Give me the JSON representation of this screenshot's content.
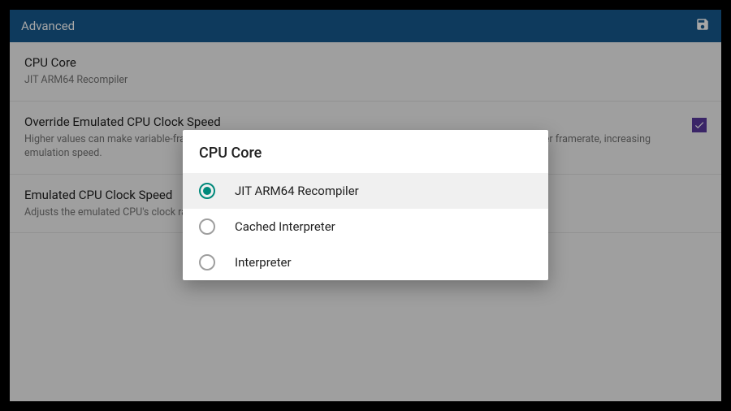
{
  "toolbar": {
    "title": "Advanced"
  },
  "settings": {
    "cpu_core": {
      "title": "CPU Core",
      "value": "JIT ARM64 Recompiler"
    },
    "override_clock": {
      "title": "Override Emulated CPU Clock Speed",
      "description": "Higher values can make variable-framerate games run at a higher framerate. Lower values make games run at a lower framerate, increasing emulation speed.",
      "checked": true
    },
    "clock_speed": {
      "title": "Emulated CPU Clock Speed",
      "description": "Adjusts the emulated CPU's clock rate."
    }
  },
  "dialog": {
    "title": "CPU Core",
    "options": [
      {
        "label": "JIT ARM64 Recompiler",
        "selected": true
      },
      {
        "label": "Cached Interpreter",
        "selected": false
      },
      {
        "label": "Interpreter",
        "selected": false
      }
    ]
  }
}
